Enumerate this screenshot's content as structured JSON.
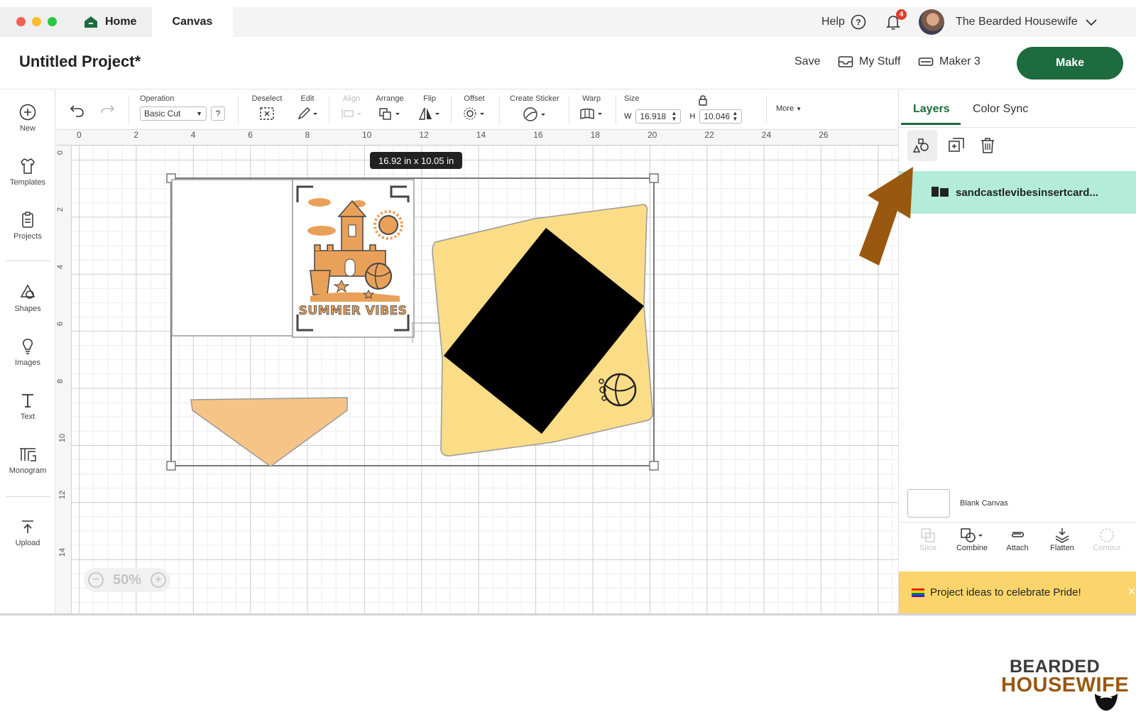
{
  "window": {
    "tabs": [
      {
        "label": "Home"
      },
      {
        "label": "Canvas"
      }
    ],
    "help_label": "Help",
    "notification_count": "4",
    "user_name": "The Bearded Housewife"
  },
  "header": {
    "project_title": "Untitled Project*",
    "save_label": "Save",
    "my_stuff_label": "My Stuff",
    "machine_label": "Maker 3",
    "make_label": "Make"
  },
  "left_tools": [
    {
      "label": "New",
      "icon": "plus-circle-icon"
    },
    {
      "label": "Templates",
      "icon": "shirt-icon"
    },
    {
      "label": "Projects",
      "icon": "clipboard-icon"
    },
    {
      "label": "Shapes",
      "icon": "shapes-icon"
    },
    {
      "label": "Images",
      "icon": "lightbulb-icon"
    },
    {
      "label": "Text",
      "icon": "text-icon"
    },
    {
      "label": "Monogram",
      "icon": "monogram-icon"
    },
    {
      "label": "Upload",
      "icon": "upload-icon"
    }
  ],
  "edit_toolbar": {
    "operation_label": "Operation",
    "operation_value": "Basic Cut",
    "help_char": "?",
    "deselect_label": "Deselect",
    "edit_label": "Edit",
    "align_label": "Align",
    "arrange_label": "Arrange",
    "flip_label": "Flip",
    "offset_label": "Offset",
    "create_sticker_label": "Create Sticker",
    "warp_label": "Warp",
    "size_label": "Size",
    "width_prefix": "W",
    "width_value": "16.918",
    "height_prefix": "H",
    "height_value": "10.046",
    "more_label": "More"
  },
  "rulers": {
    "top": [
      "0",
      "2",
      "4",
      "6",
      "8",
      "10",
      "12",
      "14",
      "16",
      "18",
      "20",
      "22",
      "24",
      "26"
    ],
    "left": [
      "0",
      "2",
      "4",
      "6",
      "8",
      "10",
      "12",
      "14"
    ]
  },
  "canvas": {
    "size_tooltip": "16.92  in x 10.05  in",
    "card_text": "SUMMER VIBES",
    "zoom_label": "50%",
    "colors": {
      "card_orange": "#e9a15a",
      "envelope_yellow": "#fbdc87",
      "flap_orange": "#f7c487",
      "envelope_black": "#000000"
    }
  },
  "right_panel": {
    "tabs": [
      {
        "label": "Layers"
      },
      {
        "label": "Color Sync"
      }
    ],
    "layer_name": "sandcastlevibesinsertcard...",
    "blank_canvas_label": "Blank Canvas",
    "bottom_tools": [
      {
        "label": "Slice",
        "enabled": false
      },
      {
        "label": "Combine",
        "enabled": true
      },
      {
        "label": "Attach",
        "enabled": true
      },
      {
        "label": "Flatten",
        "enabled": true
      },
      {
        "label": "Contour",
        "enabled": false
      }
    ],
    "promo_text": "Project ideas to celebrate Pride!",
    "promo_close": "×"
  },
  "watermark": {
    "line1": "BEARDED",
    "line2": "HOUSEWIFE"
  }
}
